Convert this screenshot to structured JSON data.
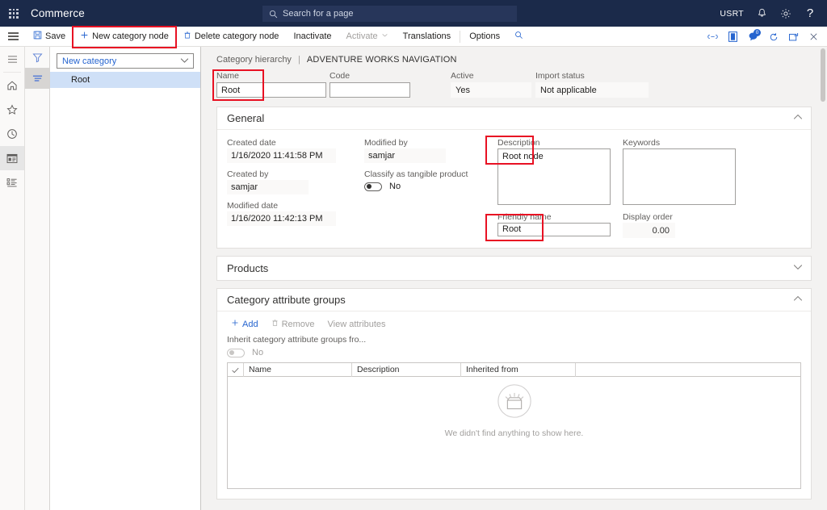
{
  "topnav": {
    "waffle_icon": "waffle-grid-icon",
    "brand": "Commerce",
    "search_placeholder": "Search for a page",
    "search_icon": "search-icon",
    "company": "USRT",
    "notifications_icon": "bell-icon",
    "settings_icon": "gear-icon",
    "help_icon": "question-mark-icon"
  },
  "commandbar": {
    "hamburger_icon": "hamburger-icon",
    "buttons": [
      {
        "label": "Save",
        "icon": "save-disk-icon",
        "disabled": false
      },
      {
        "label": "New category node",
        "icon": "plus-icon",
        "disabled": false,
        "highlighted": true
      },
      {
        "label": "Delete category node",
        "icon": "trash-icon",
        "disabled": false
      },
      {
        "label": "Inactivate",
        "icon": "",
        "disabled": false
      },
      {
        "label": "Activate",
        "icon": "chevron-down-icon",
        "disabled": true
      },
      {
        "label": "Translations",
        "icon": "",
        "disabled": false
      },
      {
        "label": "Options",
        "icon": "",
        "disabled": false
      }
    ],
    "search_icon": "search-icon",
    "right_icons": [
      {
        "name": "attach-link-icon",
        "badge": ""
      },
      {
        "name": "office-app-icon",
        "badge": ""
      },
      {
        "name": "chat-feedback-icon",
        "badge": "0"
      },
      {
        "name": "refresh-icon",
        "badge": ""
      },
      {
        "name": "popout-window-icon",
        "badge": ""
      },
      {
        "name": "close-icon",
        "badge": ""
      }
    ]
  },
  "rail": {
    "items": [
      {
        "name": "nav-toggle-icon",
        "selected": false
      },
      {
        "name": "home-icon",
        "selected": false
      },
      {
        "name": "favorites-star-icon",
        "selected": false
      },
      {
        "name": "recent-clock-icon",
        "selected": false
      },
      {
        "name": "workspaces-icon",
        "selected": true
      },
      {
        "name": "modules-list-icon",
        "selected": false
      }
    ]
  },
  "filter_rail": {
    "items": [
      {
        "name": "filter-funnel-icon",
        "selected": false
      },
      {
        "name": "hierarchy-list-icon",
        "selected": true
      }
    ]
  },
  "tree": {
    "dropdown_value": "New category",
    "dropdown_icon": "chevron-down-icon",
    "nodes": [
      {
        "label": "Root",
        "selected": true
      }
    ]
  },
  "breadcrumb": {
    "parent": "Category hierarchy",
    "separator": "|",
    "current": "ADVENTURE WORKS NAVIGATION"
  },
  "header_fields": [
    {
      "label": "Name",
      "value": "Root",
      "editable": true,
      "highlighted": true
    },
    {
      "label": "Code",
      "value": "",
      "editable": true,
      "highlighted": false
    },
    {
      "label": "Active",
      "value": "Yes",
      "editable": false,
      "highlighted": false
    },
    {
      "label": "Import status",
      "value": "Not applicable",
      "editable": false,
      "highlighted": false
    }
  ],
  "sections": {
    "general": {
      "title": "General",
      "expanded": true,
      "chevron": "chevron-up-icon",
      "col1": [
        {
          "label": "Created date",
          "value": "1/16/2020 11:41:58 PM"
        },
        {
          "label": "Created by",
          "value": "samjar"
        },
        {
          "label": "Modified date",
          "value": "1/16/2020 11:42:13 PM"
        }
      ],
      "col2": [
        {
          "label": "Modified by",
          "value": "samjar"
        }
      ],
      "toggle": {
        "label": "Classify as tangible product",
        "value": "No",
        "on": false,
        "disabled": false
      },
      "description": {
        "label": "Description",
        "value": "Root node",
        "highlighted": true
      },
      "keywords": {
        "label": "Keywords",
        "value": "",
        "highlighted": false
      },
      "friendly_name": {
        "label": "Friendly name",
        "value": "Root",
        "highlighted": true
      },
      "display_order": {
        "label": "Display order",
        "value": "0.00",
        "highlighted": false
      }
    },
    "products": {
      "title": "Products",
      "expanded": false,
      "chevron": "chevron-down-icon"
    },
    "attribute_groups": {
      "title": "Category attribute groups",
      "expanded": true,
      "chevron": "chevron-up-icon",
      "toolbar": [
        {
          "label": "Add",
          "icon": "plus-icon",
          "disabled": false
        },
        {
          "label": "Remove",
          "icon": "trash-icon",
          "disabled": true
        },
        {
          "label": "View attributes",
          "icon": "",
          "disabled": true
        }
      ],
      "inherit_toggle": {
        "label": "Inherit category attribute groups fro...",
        "value": "No",
        "on": false,
        "disabled": true
      },
      "grid": {
        "check_icon": "checkmark-icon",
        "columns": [
          "Name",
          "Description",
          "Inherited from"
        ],
        "rows": [],
        "empty_icon": "empty-box-icon",
        "empty_text": "We didn't find anything to show here."
      }
    }
  },
  "colors": {
    "nav_background": "#1b2a4a",
    "accent_blue": "#2564cf",
    "highlight_red": "#e81123",
    "tree_selected": "#cfe0f7",
    "page_background": "#f3f2f1"
  }
}
